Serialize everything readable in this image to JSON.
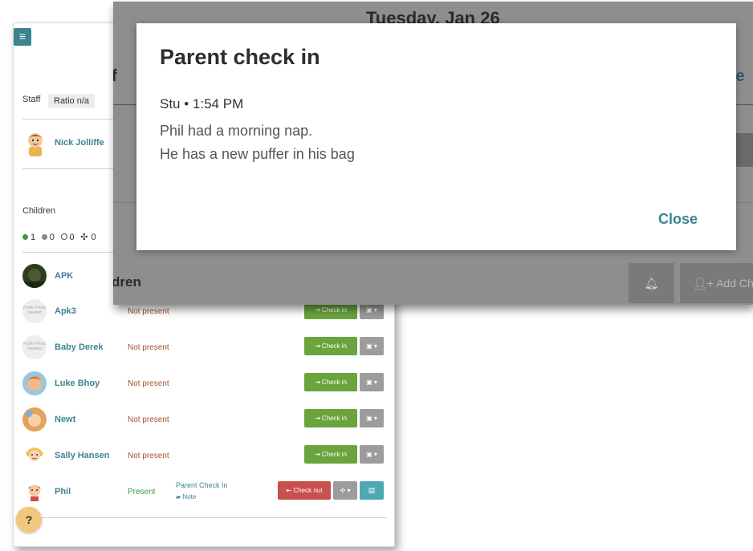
{
  "header": {
    "date": "Tuesday, Jan 26"
  },
  "background_fragments": {
    "staff_tail": "f",
    "tab_tail": "le",
    "children_tail": "dren",
    "add_child_label": "Add Ch"
  },
  "staff": {
    "heading": "Staff",
    "ratio": "Ratio n/a",
    "members": [
      {
        "name": "Nick Jolliffe"
      }
    ]
  },
  "children": {
    "heading": "Children",
    "counts": {
      "present": "1",
      "absent": "0",
      "empty": "0",
      "moved": "0"
    },
    "rows": [
      {
        "name": "APK",
        "status": "",
        "action": ""
      },
      {
        "name": "Apk3",
        "status": "Not present",
        "action": "Check in"
      },
      {
        "name": "Baby Derek",
        "status": "Not present",
        "action": "Check in"
      },
      {
        "name": "Luke Bhoy",
        "status": "Not present",
        "action": "Check in"
      },
      {
        "name": "Newt",
        "status": "Not present",
        "action": "Check in"
      },
      {
        "name": "Sally Hansen",
        "status": "Not present",
        "action": "Check in"
      },
      {
        "name": "Phil",
        "status": "Present",
        "action": "Check out",
        "parent_check_in": "Parent Check In",
        "note": "Note"
      }
    ],
    "placeholder_photo_text": "Profile Photo Needed"
  },
  "modal": {
    "title": "Parent check in",
    "meta": "Stu • 1:54 PM",
    "lines": [
      "Phil had a morning nap.",
      "He has a new puffer in his bag"
    ],
    "close_label": "Close"
  },
  "help": {
    "icon": "question-icon"
  },
  "colors": {
    "accent": "#3b8490",
    "check_in": "#6aa43c",
    "check_out": "#c9504c",
    "present": "#3a9a3a",
    "not_present": "#a0522d"
  }
}
